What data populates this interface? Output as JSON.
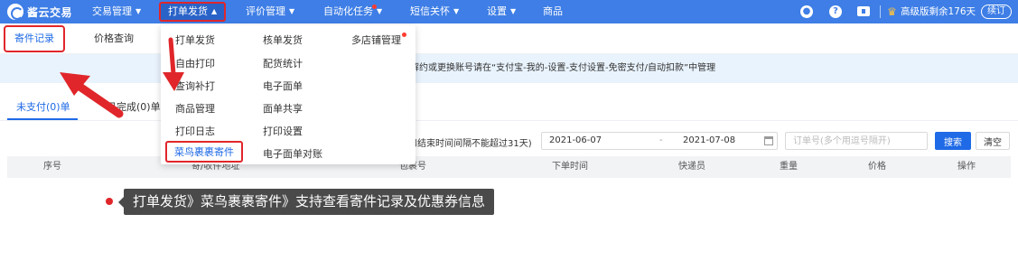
{
  "topbar": {
    "logo_text": "酱云交易",
    "nav": [
      {
        "label": "交易管理"
      },
      {
        "label": "打单发货"
      },
      {
        "label": "评价管理"
      },
      {
        "label": "自动化任务"
      },
      {
        "label": "短信关怀"
      },
      {
        "label": "设置"
      },
      {
        "label": "商品"
      }
    ],
    "help_icon_glyph": "?",
    "plan_text": "高级版剩余176天",
    "renew_label": "续订"
  },
  "subtabs": [
    {
      "label": "寄件记录"
    },
    {
      "label": "价格查询"
    }
  ],
  "dropdown": {
    "col1": [
      "打单发货",
      "自由打印",
      "查询补打",
      "商品管理",
      "打印日志",
      "菜鸟裹裹寄件"
    ],
    "col2": [
      "核单发货",
      "配货统计",
      "电子面单",
      "面单共享",
      "打印设置",
      "电子面单对账"
    ],
    "col3": [
      "多店铺管理"
    ]
  },
  "notice": {
    "text": "解约或更换账号请在“支付宝-我的-设置-支付设置-免密支付/自动扣款”中管理"
  },
  "status_tabs": [
    {
      "label": "未支付(0)单"
    },
    {
      "label": "已完成(0)单"
    }
  ],
  "search": {
    "hint": "和结束时间间隔不能超过31天)",
    "date_start": "2021-06-07",
    "date_sep": "-",
    "date_end": "2021-07-08",
    "order_placeholder": "订单号(多个用逗号隔开)",
    "search_label": "搜索",
    "clear_label": "清空"
  },
  "table": {
    "columns": [
      "序号",
      "寄/收件地址",
      "包裹号",
      "下单时间",
      "快递员",
      "重量",
      "价格",
      "操作"
    ]
  },
  "tooltip": {
    "text": "打单发货》菜鸟裹裹寄件》支持查看寄件记录及优惠券信息"
  }
}
